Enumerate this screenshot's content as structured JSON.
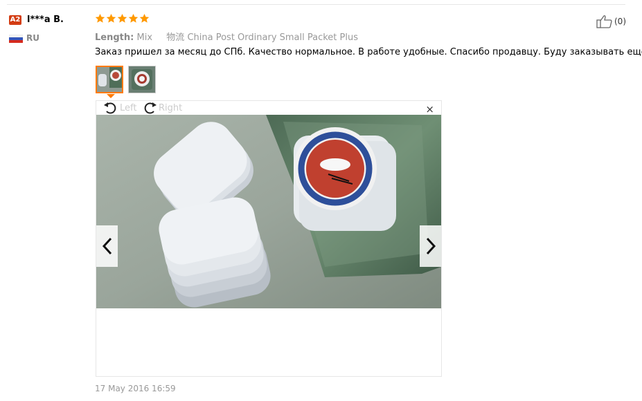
{
  "reviewer": {
    "level_badge": "A2",
    "name": "l***a B.",
    "country": "RU"
  },
  "rating": {
    "stars": 5,
    "max": 5,
    "color": "#ff9900"
  },
  "meta": {
    "length_label": "Length:",
    "length_value": "Mix",
    "shipping_label": "物流",
    "shipping_value": "China Post Ordinary Small Packet Plus"
  },
  "review_text": "Заказ пришел за месяц до СПб. Качество нормальное. В работе удобные. Спасибо продавцу. Буду заказывать еще.",
  "viewer": {
    "rotate_left": "Left",
    "rotate_right": "Right",
    "close": "×"
  },
  "helpful": {
    "count": "(0)"
  },
  "date": "17 May 2016 16:59",
  "colors": {
    "accent": "#ff7a00",
    "badge": "#d33c13",
    "muted": "#999999"
  }
}
